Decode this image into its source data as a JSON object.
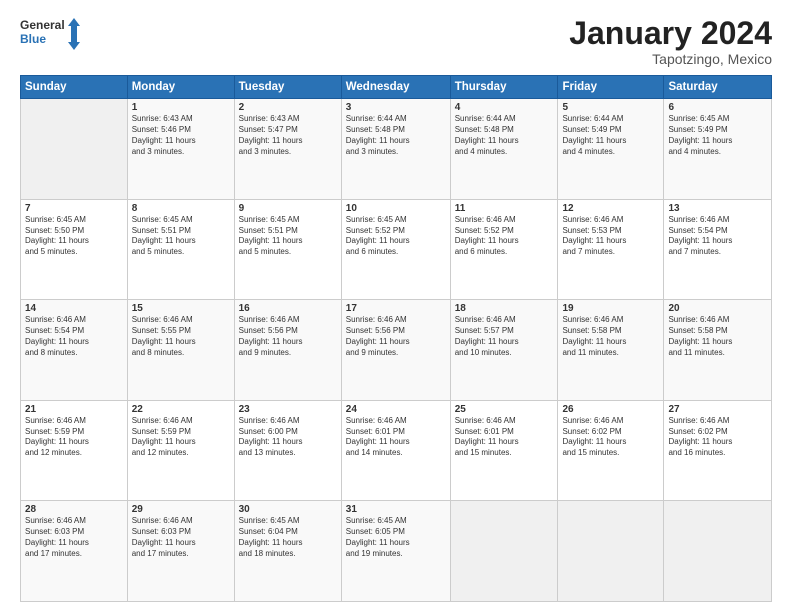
{
  "logo": {
    "general": "General",
    "blue": "Blue"
  },
  "title": "January 2024",
  "location": "Tapotzingo, Mexico",
  "days_header": [
    "Sunday",
    "Monday",
    "Tuesday",
    "Wednesday",
    "Thursday",
    "Friday",
    "Saturday"
  ],
  "weeks": [
    [
      {
        "num": "",
        "lines": []
      },
      {
        "num": "1",
        "lines": [
          "Sunrise: 6:43 AM",
          "Sunset: 5:46 PM",
          "Daylight: 11 hours",
          "and 3 minutes."
        ]
      },
      {
        "num": "2",
        "lines": [
          "Sunrise: 6:43 AM",
          "Sunset: 5:47 PM",
          "Daylight: 11 hours",
          "and 3 minutes."
        ]
      },
      {
        "num": "3",
        "lines": [
          "Sunrise: 6:44 AM",
          "Sunset: 5:48 PM",
          "Daylight: 11 hours",
          "and 3 minutes."
        ]
      },
      {
        "num": "4",
        "lines": [
          "Sunrise: 6:44 AM",
          "Sunset: 5:48 PM",
          "Daylight: 11 hours",
          "and 4 minutes."
        ]
      },
      {
        "num": "5",
        "lines": [
          "Sunrise: 6:44 AM",
          "Sunset: 5:49 PM",
          "Daylight: 11 hours",
          "and 4 minutes."
        ]
      },
      {
        "num": "6",
        "lines": [
          "Sunrise: 6:45 AM",
          "Sunset: 5:49 PM",
          "Daylight: 11 hours",
          "and 4 minutes."
        ]
      }
    ],
    [
      {
        "num": "7",
        "lines": [
          "Sunrise: 6:45 AM",
          "Sunset: 5:50 PM",
          "Daylight: 11 hours",
          "and 5 minutes."
        ]
      },
      {
        "num": "8",
        "lines": [
          "Sunrise: 6:45 AM",
          "Sunset: 5:51 PM",
          "Daylight: 11 hours",
          "and 5 minutes."
        ]
      },
      {
        "num": "9",
        "lines": [
          "Sunrise: 6:45 AM",
          "Sunset: 5:51 PM",
          "Daylight: 11 hours",
          "and 5 minutes."
        ]
      },
      {
        "num": "10",
        "lines": [
          "Sunrise: 6:45 AM",
          "Sunset: 5:52 PM",
          "Daylight: 11 hours",
          "and 6 minutes."
        ]
      },
      {
        "num": "11",
        "lines": [
          "Sunrise: 6:46 AM",
          "Sunset: 5:52 PM",
          "Daylight: 11 hours",
          "and 6 minutes."
        ]
      },
      {
        "num": "12",
        "lines": [
          "Sunrise: 6:46 AM",
          "Sunset: 5:53 PM",
          "Daylight: 11 hours",
          "and 7 minutes."
        ]
      },
      {
        "num": "13",
        "lines": [
          "Sunrise: 6:46 AM",
          "Sunset: 5:54 PM",
          "Daylight: 11 hours",
          "and 7 minutes."
        ]
      }
    ],
    [
      {
        "num": "14",
        "lines": [
          "Sunrise: 6:46 AM",
          "Sunset: 5:54 PM",
          "Daylight: 11 hours",
          "and 8 minutes."
        ]
      },
      {
        "num": "15",
        "lines": [
          "Sunrise: 6:46 AM",
          "Sunset: 5:55 PM",
          "Daylight: 11 hours",
          "and 8 minutes."
        ]
      },
      {
        "num": "16",
        "lines": [
          "Sunrise: 6:46 AM",
          "Sunset: 5:56 PM",
          "Daylight: 11 hours",
          "and 9 minutes."
        ]
      },
      {
        "num": "17",
        "lines": [
          "Sunrise: 6:46 AM",
          "Sunset: 5:56 PM",
          "Daylight: 11 hours",
          "and 9 minutes."
        ]
      },
      {
        "num": "18",
        "lines": [
          "Sunrise: 6:46 AM",
          "Sunset: 5:57 PM",
          "Daylight: 11 hours",
          "and 10 minutes."
        ]
      },
      {
        "num": "19",
        "lines": [
          "Sunrise: 6:46 AM",
          "Sunset: 5:58 PM",
          "Daylight: 11 hours",
          "and 11 minutes."
        ]
      },
      {
        "num": "20",
        "lines": [
          "Sunrise: 6:46 AM",
          "Sunset: 5:58 PM",
          "Daylight: 11 hours",
          "and 11 minutes."
        ]
      }
    ],
    [
      {
        "num": "21",
        "lines": [
          "Sunrise: 6:46 AM",
          "Sunset: 5:59 PM",
          "Daylight: 11 hours",
          "and 12 minutes."
        ]
      },
      {
        "num": "22",
        "lines": [
          "Sunrise: 6:46 AM",
          "Sunset: 5:59 PM",
          "Daylight: 11 hours",
          "and 12 minutes."
        ]
      },
      {
        "num": "23",
        "lines": [
          "Sunrise: 6:46 AM",
          "Sunset: 6:00 PM",
          "Daylight: 11 hours",
          "and 13 minutes."
        ]
      },
      {
        "num": "24",
        "lines": [
          "Sunrise: 6:46 AM",
          "Sunset: 6:01 PM",
          "Daylight: 11 hours",
          "and 14 minutes."
        ]
      },
      {
        "num": "25",
        "lines": [
          "Sunrise: 6:46 AM",
          "Sunset: 6:01 PM",
          "Daylight: 11 hours",
          "and 15 minutes."
        ]
      },
      {
        "num": "26",
        "lines": [
          "Sunrise: 6:46 AM",
          "Sunset: 6:02 PM",
          "Daylight: 11 hours",
          "and 15 minutes."
        ]
      },
      {
        "num": "27",
        "lines": [
          "Sunrise: 6:46 AM",
          "Sunset: 6:02 PM",
          "Daylight: 11 hours",
          "and 16 minutes."
        ]
      }
    ],
    [
      {
        "num": "28",
        "lines": [
          "Sunrise: 6:46 AM",
          "Sunset: 6:03 PM",
          "Daylight: 11 hours",
          "and 17 minutes."
        ]
      },
      {
        "num": "29",
        "lines": [
          "Sunrise: 6:46 AM",
          "Sunset: 6:03 PM",
          "Daylight: 11 hours",
          "and 17 minutes."
        ]
      },
      {
        "num": "30",
        "lines": [
          "Sunrise: 6:45 AM",
          "Sunset: 6:04 PM",
          "Daylight: 11 hours",
          "and 18 minutes."
        ]
      },
      {
        "num": "31",
        "lines": [
          "Sunrise: 6:45 AM",
          "Sunset: 6:05 PM",
          "Daylight: 11 hours",
          "and 19 minutes."
        ]
      },
      {
        "num": "",
        "lines": []
      },
      {
        "num": "",
        "lines": []
      },
      {
        "num": "",
        "lines": []
      }
    ]
  ]
}
